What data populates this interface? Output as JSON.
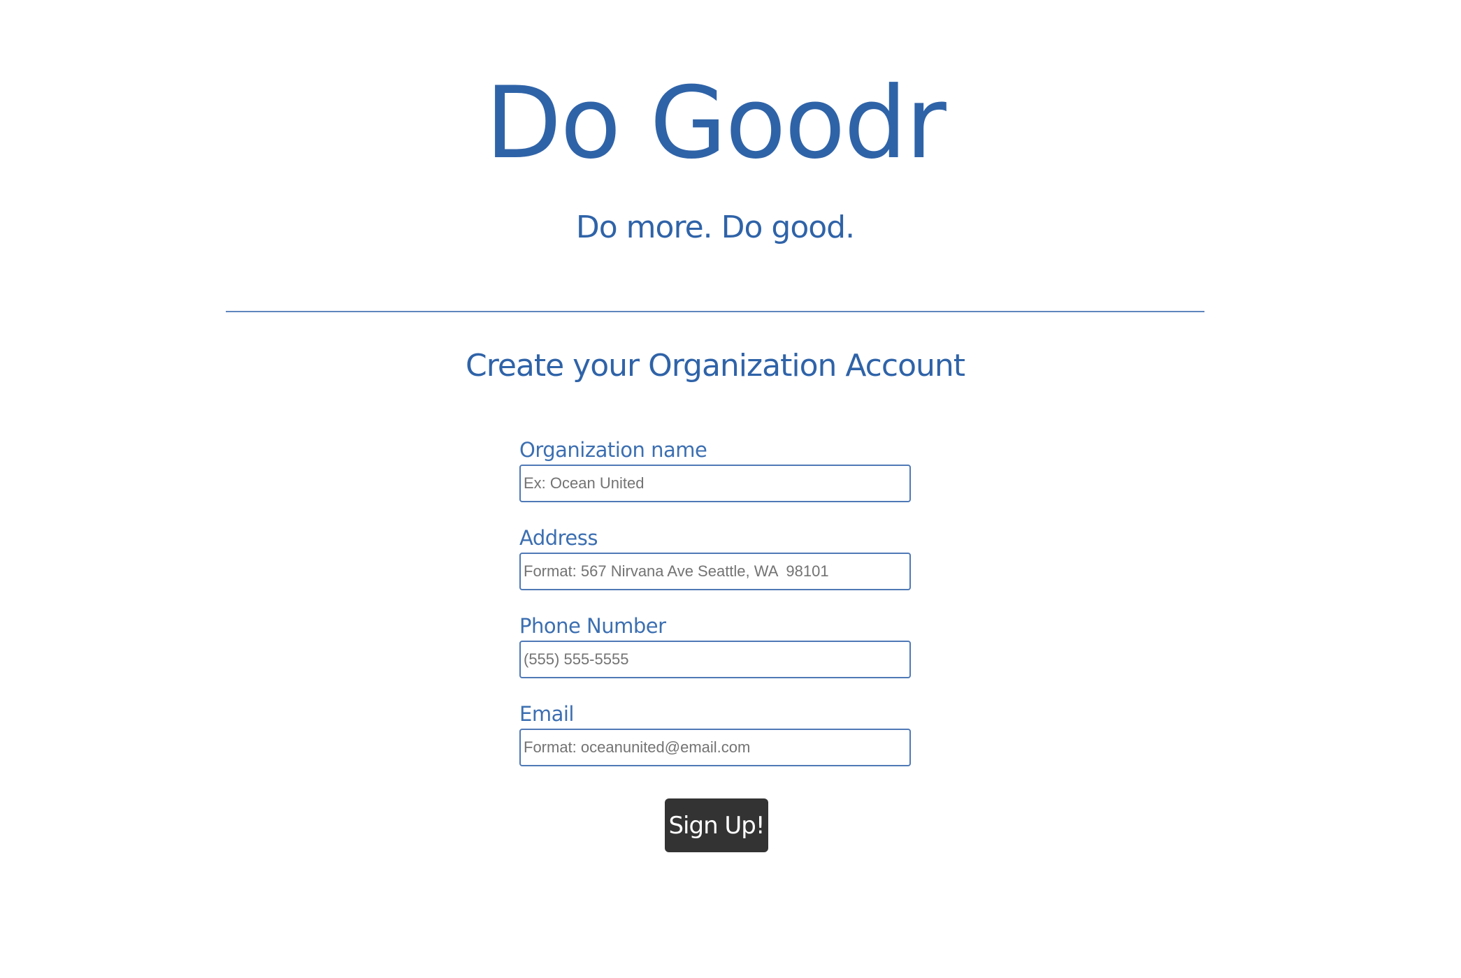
{
  "header": {
    "title": "Do Goodr",
    "tagline": "Do more. Do good."
  },
  "form": {
    "title": "Create your Organization Account",
    "fields": [
      {
        "label": "Organization name",
        "placeholder": "Ex: Ocean United",
        "value": ""
      },
      {
        "label": "Address",
        "placeholder": "Format: 567 Nirvana Ave Seattle, WA  98101",
        "value": ""
      },
      {
        "label": "Phone Number",
        "placeholder": "(555) 555-5555",
        "value": ""
      },
      {
        "label": "Email",
        "placeholder": "Format: oceanunited@email.com",
        "value": ""
      }
    ],
    "submit_label": "Sign Up!"
  },
  "colors": {
    "brand_blue": "#2f63a8",
    "button_bg": "#333333",
    "background": "#ffffff"
  }
}
